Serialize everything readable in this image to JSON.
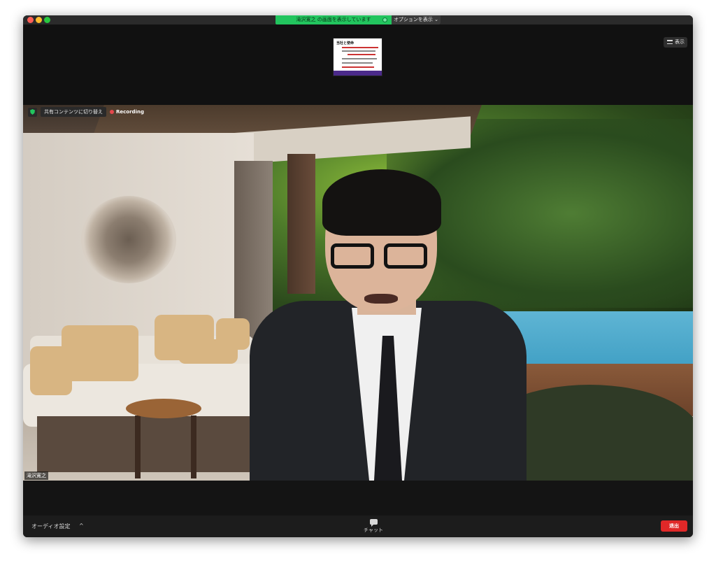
{
  "window": {
    "share_banner": "滝沢寛之 の画面を表示しています",
    "options_label": "オプションを表示",
    "options_chevron": "⌄",
    "view_label": "表示"
  },
  "shared_thumbnail": {
    "title": "当社と使命"
  },
  "video": {
    "switch_label": "共有コンテンツに切り替え",
    "recording_label": "Recording",
    "participant_name": "滝沢寛之"
  },
  "toolbar": {
    "audio_settings": "オーディオ設定",
    "audio_chevron": "^",
    "chat_label": "チャット",
    "leave_label": "退出"
  },
  "colors": {
    "share_banner": "#22c55e",
    "recording_dot": "#e5484d",
    "leave_button": "#e02828"
  }
}
